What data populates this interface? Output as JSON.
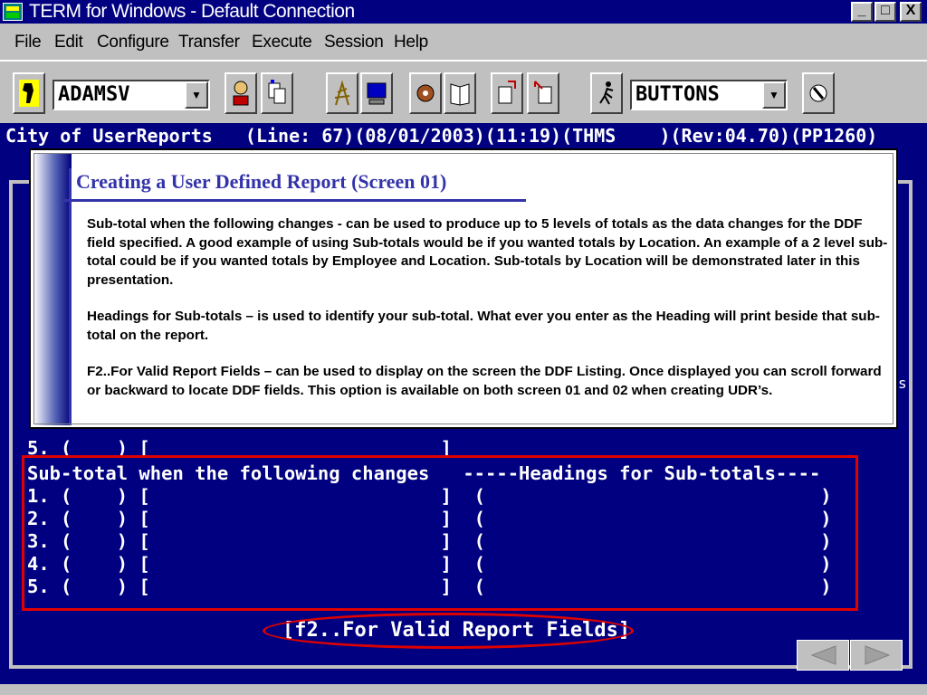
{
  "window": {
    "title": "TERM for Windows - Default Connection",
    "minimize_label": "_",
    "maximize_label": "□",
    "close_label": "X"
  },
  "menu": [
    "File",
    "Edit",
    "Configure",
    "Transfer",
    "Execute",
    "Session",
    "Help"
  ],
  "toolbar": {
    "connection_combo": "ADAMSV",
    "buttons_combo": "BUTTONS"
  },
  "terminal": {
    "status_line": "City of UserReports   (Line: 67)(08/01/2003)(11:19)(THMS    )(Rev:04.70)(PP1260)",
    "line_5_top": "5. (    ) [                          ]",
    "subtotal_header": "Sub-total when the following changes   -----Headings for Sub-totals----",
    "rows": [
      "1. (    ) [                          ]  (                              )",
      "2. (    ) [                          ]  (                              )",
      "3. (    ) [                          ]  (                              )",
      "4. (    ) [                          ]  (                              )",
      "5. (    ) [                          ]  (                              )"
    ],
    "f2_hint": "[f2..For Valid Report Fields]",
    "partial_char": "s"
  },
  "callout": {
    "title": "Creating a User Defined Report  (Screen 01)",
    "paragraphs": [
      "Sub-total when the following changes -  can be used to produce up to 5 levels of totals as the data changes for the DDF field specified.   A good example of using Sub-totals would be if you wanted totals by Location.  An example of a 2 level sub-total could be if you wanted totals by Employee and Location.  Sub-totals by Location will be demonstrated later in this presentation.",
      "Headings for Sub-totals – is used to identify your sub-total.  What ever you enter as the Heading will print beside that sub-total on the report.",
      "F2..For Valid Report Fields – can be used to display on the screen the DDF Listing.  Once displayed you can scroll forward or backward to locate DDF fields.  This option is available on both screen 01 and 02 when creating UDR’s."
    ]
  },
  "colors": {
    "terminal_bg": "#000080",
    "highlight": "#e00000",
    "callout_accent": "#3333aa"
  }
}
